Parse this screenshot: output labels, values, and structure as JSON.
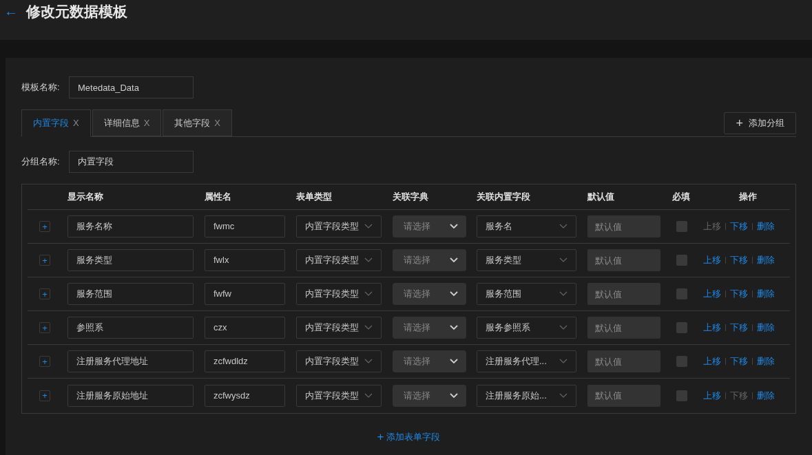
{
  "header": {
    "back_icon": "←",
    "title": "修改元数据模板"
  },
  "template_name": {
    "label": "模板名称:",
    "value": "Metedata_Data"
  },
  "tabs": [
    {
      "label": "内置字段",
      "close": "X",
      "selected": true
    },
    {
      "label": "详细信息",
      "close": "X",
      "selected": false
    },
    {
      "label": "其他字段",
      "close": "X",
      "selected": false
    }
  ],
  "add_group_button": {
    "icon": "+",
    "label": "添加分组"
  },
  "group_name": {
    "label": "分组名称:",
    "value": "内置字段"
  },
  "table": {
    "columns": [
      "显示名称",
      "属性名",
      "表单类型",
      "关联字典",
      "关联内置字段",
      "默认值",
      "必填",
      "操作"
    ],
    "rows": [
      {
        "expand": "+",
        "display_name": "服务名称",
        "attribute": "fwmc",
        "form_type": "内置字段类型",
        "dictionary": {
          "placeholder": "请选择",
          "disabled": true
        },
        "builtin_field": "服务名",
        "default_value": {
          "placeholder": "默认值"
        },
        "required": false,
        "actions": [
          {
            "label": "上移",
            "disabled": true
          },
          {
            "label": "下移",
            "disabled": false
          },
          {
            "label": "删除",
            "disabled": false
          }
        ]
      },
      {
        "expand": "+",
        "display_name": "服务类型",
        "attribute": "fwlx",
        "form_type": "内置字段类型",
        "dictionary": {
          "placeholder": "请选择",
          "disabled": true
        },
        "builtin_field": "服务类型",
        "default_value": {
          "placeholder": "默认值"
        },
        "required": false,
        "actions": [
          {
            "label": "上移",
            "disabled": false
          },
          {
            "label": "下移",
            "disabled": false
          },
          {
            "label": "删除",
            "disabled": false
          }
        ]
      },
      {
        "expand": "+",
        "display_name": "服务范围",
        "attribute": "fwfw",
        "form_type": "内置字段类型",
        "dictionary": {
          "placeholder": "请选择",
          "disabled": true
        },
        "builtin_field": "服务范围",
        "default_value": {
          "placeholder": "默认值"
        },
        "required": false,
        "actions": [
          {
            "label": "上移",
            "disabled": false
          },
          {
            "label": "下移",
            "disabled": false
          },
          {
            "label": "删除",
            "disabled": false
          }
        ]
      },
      {
        "expand": "+",
        "display_name": "参照系",
        "attribute": "czx",
        "form_type": "内置字段类型",
        "dictionary": {
          "placeholder": "请选择",
          "disabled": true
        },
        "builtin_field": "服务参照系",
        "default_value": {
          "placeholder": "默认值"
        },
        "required": false,
        "actions": [
          {
            "label": "上移",
            "disabled": false
          },
          {
            "label": "下移",
            "disabled": false
          },
          {
            "label": "删除",
            "disabled": false
          }
        ]
      },
      {
        "expand": "+",
        "display_name": "注册服务代理地址",
        "attribute": "zcfwdldz",
        "form_type": "内置字段类型",
        "dictionary": {
          "placeholder": "请选择",
          "disabled": true
        },
        "builtin_field": "注册服务代理...",
        "default_value": {
          "placeholder": "默认值"
        },
        "required": false,
        "actions": [
          {
            "label": "上移",
            "disabled": false
          },
          {
            "label": "下移",
            "disabled": false
          },
          {
            "label": "删除",
            "disabled": false
          }
        ]
      },
      {
        "expand": "+",
        "display_name": "注册服务原始地址",
        "attribute": "zcfwysdz",
        "form_type": "内置字段类型",
        "dictionary": {
          "placeholder": "请选择",
          "disabled": true
        },
        "builtin_field": "注册服务原始...",
        "default_value": {
          "placeholder": "默认值"
        },
        "required": false,
        "actions": [
          {
            "label": "上移",
            "disabled": false
          },
          {
            "label": "下移",
            "disabled": true
          },
          {
            "label": "删除",
            "disabled": false
          }
        ]
      }
    ]
  },
  "add_field_button": {
    "icon": "+",
    "label": "添加表单字段"
  }
}
